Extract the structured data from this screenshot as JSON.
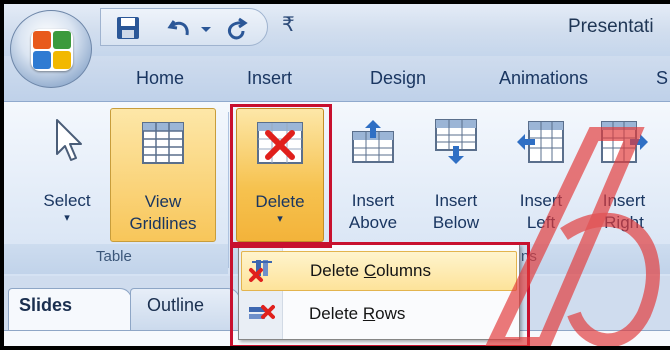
{
  "title": {
    "text": "Presentati"
  },
  "quick_access": {
    "save_icon": "save-icon",
    "undo_icon": "undo-icon",
    "redo_icon": "redo-icon",
    "customize_glyph": "₹"
  },
  "tabs": [
    {
      "label": "Home"
    },
    {
      "label": "Insert"
    },
    {
      "label": "Design"
    },
    {
      "label": "Animations"
    },
    {
      "label": "S"
    }
  ],
  "ribbon": {
    "select": {
      "label": "Select",
      "arrow": "▾"
    },
    "view_gridlines": {
      "line1": "View",
      "line2": "Gridlines"
    },
    "delete": {
      "label": "Delete",
      "arrow": "▾"
    },
    "insert_above": {
      "line1": "Insert",
      "line2": "Above"
    },
    "insert_below": {
      "line1": "Insert",
      "line2": "Below"
    },
    "insert_left": {
      "line1": "Insert",
      "line2": "Left"
    },
    "insert_right": {
      "line1": "Insert",
      "line2": "Right"
    },
    "group_table": "Table",
    "group_rows": "ns"
  },
  "delete_menu": {
    "items": [
      {
        "label": "Delete Columns",
        "icon": "delete-columns-icon"
      },
      {
        "label": "Delete Rows",
        "icon": "delete-rows-icon"
      }
    ]
  },
  "pane": {
    "tabs": [
      {
        "label": "Slides"
      },
      {
        "label": "Outline"
      }
    ]
  },
  "colors": {
    "highlight_box": "#c8102e",
    "active_button": "#f8c65a",
    "ribbon": "#e3ecf8"
  }
}
